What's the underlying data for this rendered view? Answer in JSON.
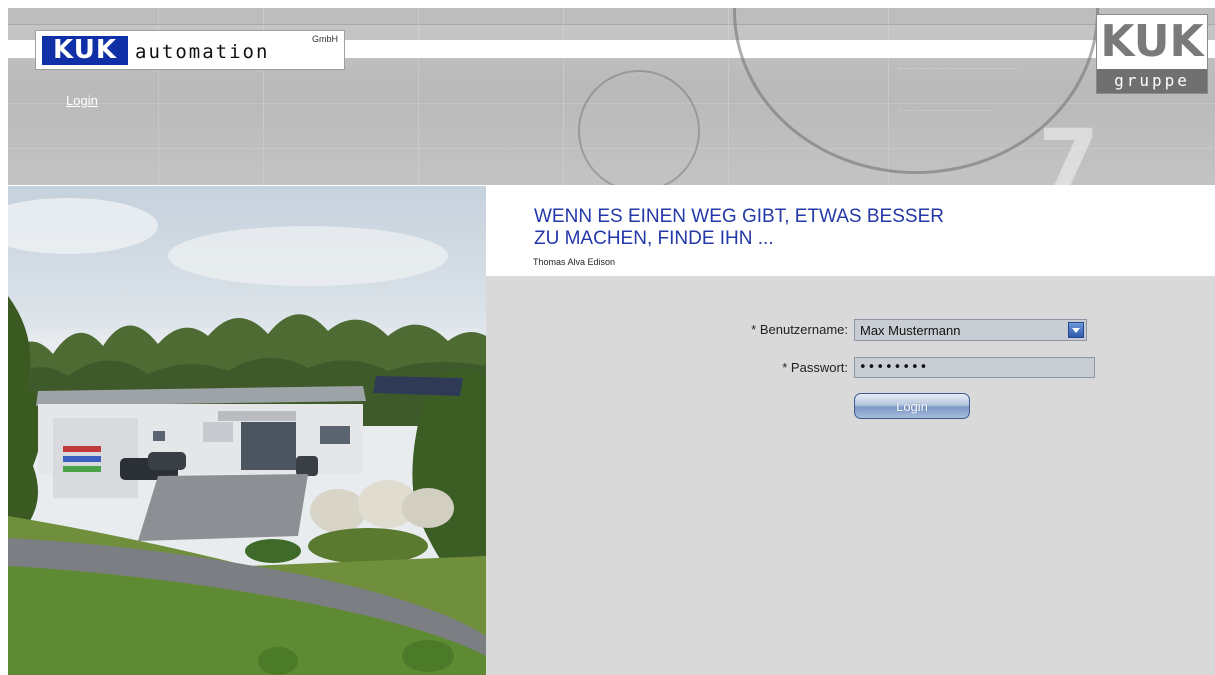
{
  "header": {
    "logo": {
      "brand": "KUK",
      "name": "automation",
      "suffix": "GmbH"
    },
    "login_link": "Login",
    "group_logo": {
      "brand": "KUK",
      "label": "gruppe"
    }
  },
  "quote": {
    "text": "WENN ES EINEN WEG GIBT, ETWAS BESSER ZU MACHEN, FINDE IHN ...",
    "author": "Thomas Alva Edison"
  },
  "login_form": {
    "username_label": "* Benutzername:",
    "username_value": "Max Mustermann",
    "password_label": "* Passwort:",
    "password_value": "••••••••",
    "submit_label": "Login"
  },
  "colors": {
    "brand_blue": "#1030a8",
    "quote_blue": "#2438a8",
    "form_background": "#d9d9d9",
    "header_gray": "#bdbdbd"
  }
}
